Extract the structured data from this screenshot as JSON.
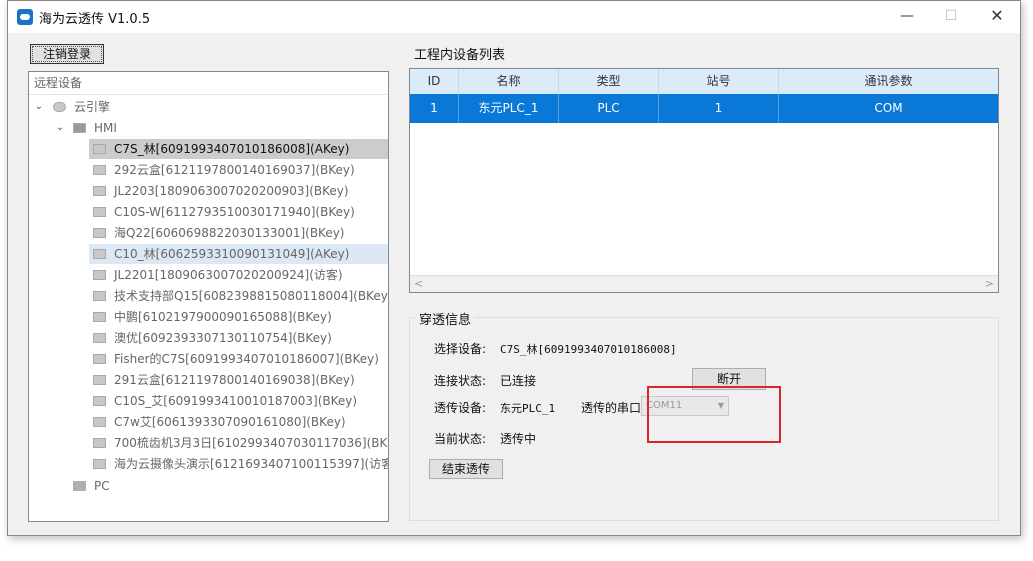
{
  "window": {
    "title": "海为云透传 V1.0.5",
    "minimize": "—",
    "maximize": "☐",
    "close": "✕"
  },
  "logout_label": "注销登录",
  "tree": {
    "header": "远程设备",
    "root": "云引擎",
    "hmi": "HMI",
    "devices": [
      "C7S_林[6091993407010186008](AKey)",
      "292云盒[6121197800140169037](BKey)",
      "JL2203[1809063007020200903](BKey)",
      "C10S-W[6112793510030171940](BKey)",
      "海Q22[6060698822030133001](BKey)",
      "C10_林[6062593310090131049](AKey)",
      "JL2201[1809063007020200924](访客)",
      "技术支持部Q15[6082398815080118004](BKey)",
      "中鹏[6102197900090165088](BKey)",
      "澳优[6092393307130110754](BKey)",
      "Fisher的C7S[6091993407010186007](BKey)",
      "291云盒[6121197800140169038](BKey)",
      "C10S_艾[6091993410010187003](BKey)",
      "C7w艾[6061393307090161080](BKey)",
      "700梳齿机3月3日[6102993407030117036](BK…",
      "海为云摄像头演示[6121693407100115397](访客)"
    ],
    "pc": "PC"
  },
  "device_list": {
    "label": "工程内设备列表",
    "columns": [
      "ID",
      "名称",
      "类型",
      "站号",
      "通讯参数"
    ],
    "rows": [
      [
        "1",
        "东元PLC_1",
        "PLC",
        "1",
        "COM"
      ]
    ],
    "scroll_left": "<",
    "scroll_right": ">"
  },
  "passthrough": {
    "title": "穿透信息",
    "select_label": "选择设备:",
    "select_value": "C7S_林[6091993407010186008]",
    "conn_label": "连接状态:",
    "conn_value": "已连接",
    "disconnect_label": "断开",
    "device_label": "透传设备:",
    "device_value": "东元PLC_1",
    "port_label": "透传的串口",
    "port_value": "COM11",
    "current_label": "当前状态:",
    "current_value": "透传中",
    "end_label": "结束透传"
  }
}
